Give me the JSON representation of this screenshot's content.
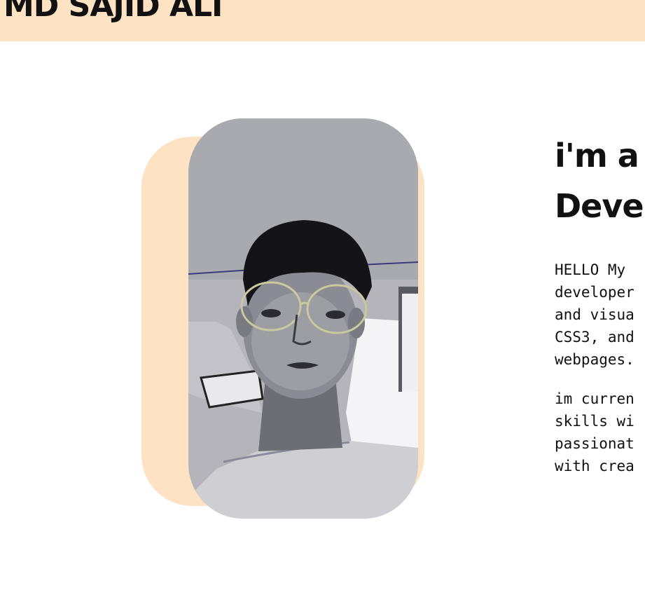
{
  "header": {
    "logo_text": "MD SAJID ALI"
  },
  "hero": {
    "headline_lines": [
      "i'm a",
      "Deve"
    ],
    "paragraph_1_lines": [
      "HELLO My",
      "developer",
      "and visua",
      "CSS3, and",
      "webpages."
    ],
    "paragraph_2_lines": [
      "im curren",
      "skills wi",
      "passionat",
      "with crea"
    ]
  },
  "colors": {
    "accent_peach": "#fde3c3",
    "text": "#111111",
    "background": "#ffffff"
  }
}
